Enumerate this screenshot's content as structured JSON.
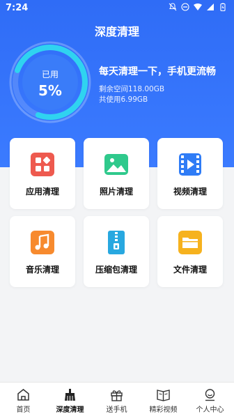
{
  "status": {
    "time": "7:24"
  },
  "header": {
    "title": "深度清理"
  },
  "gauge": {
    "label": "已用",
    "percent_text": "5%",
    "used_fraction": 0.05
  },
  "info": {
    "slogan": "每天清理一下，手机更流畅",
    "remaining": "剩余空间118.00GB",
    "used_total": "共使用6.99GB"
  },
  "categories": [
    {
      "label": "应用清理",
      "icon": "apps-icon",
      "color": "#ee5a4f"
    },
    {
      "label": "照片清理",
      "icon": "photo-icon",
      "color": "#2fc98c"
    },
    {
      "label": "视频清理",
      "icon": "video-icon",
      "color": "#2f7cf6"
    },
    {
      "label": "音乐清理",
      "icon": "music-icon",
      "color": "#f78a2e"
    },
    {
      "label": "压缩包清理",
      "icon": "zip-icon",
      "color": "#28a8e0"
    },
    {
      "label": "文件清理",
      "icon": "folder-icon",
      "color": "#f6b21e"
    }
  ],
  "tabs": [
    {
      "label": "首页",
      "icon": "home-icon"
    },
    {
      "label": "深度清理",
      "icon": "broom-icon",
      "active": true
    },
    {
      "label": "送手机",
      "icon": "gift-icon"
    },
    {
      "label": "精彩视频",
      "icon": "book-icon"
    },
    {
      "label": "个人中心",
      "icon": "user-icon"
    }
  ]
}
